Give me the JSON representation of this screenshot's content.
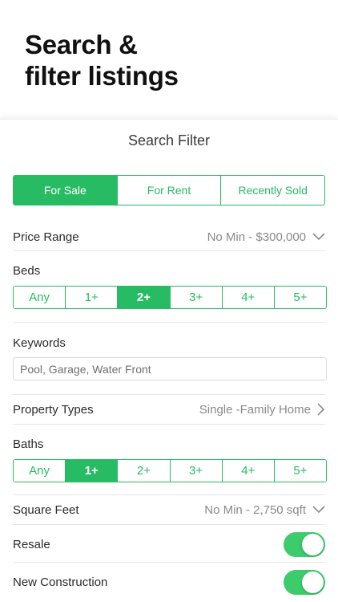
{
  "hero": {
    "line1": "Search &",
    "line2": "filter listings"
  },
  "sheet": {
    "title": "Search Filter"
  },
  "listing_type": {
    "options": [
      "For Sale",
      "For Rent",
      "Recently Sold"
    ],
    "selected": "For Sale"
  },
  "price_range": {
    "label": "Price Range",
    "value": "No Min - $300,000"
  },
  "beds": {
    "label": "Beds",
    "options": [
      "Any",
      "1+",
      "2+",
      "3+",
      "4+",
      "5+"
    ],
    "selected": "2+"
  },
  "keywords": {
    "label": "Keywords",
    "placeholder": "Pool, Garage, Water Front"
  },
  "property_types": {
    "label": "Property Types",
    "value": "Single -Family Home"
  },
  "baths": {
    "label": "Baths",
    "options": [
      "Any",
      "1+",
      "2+",
      "3+",
      "4+",
      "5+"
    ],
    "selected": "1+"
  },
  "square_feet": {
    "label": "Square Feet",
    "value": "No Min - 2,750 sqft"
  },
  "resale": {
    "label": "Resale",
    "enabled": true
  },
  "new_construction": {
    "label": "New Construction",
    "enabled": true
  },
  "colors": {
    "accent": "#27bb63",
    "toggle_on": "#3ccc6b"
  }
}
